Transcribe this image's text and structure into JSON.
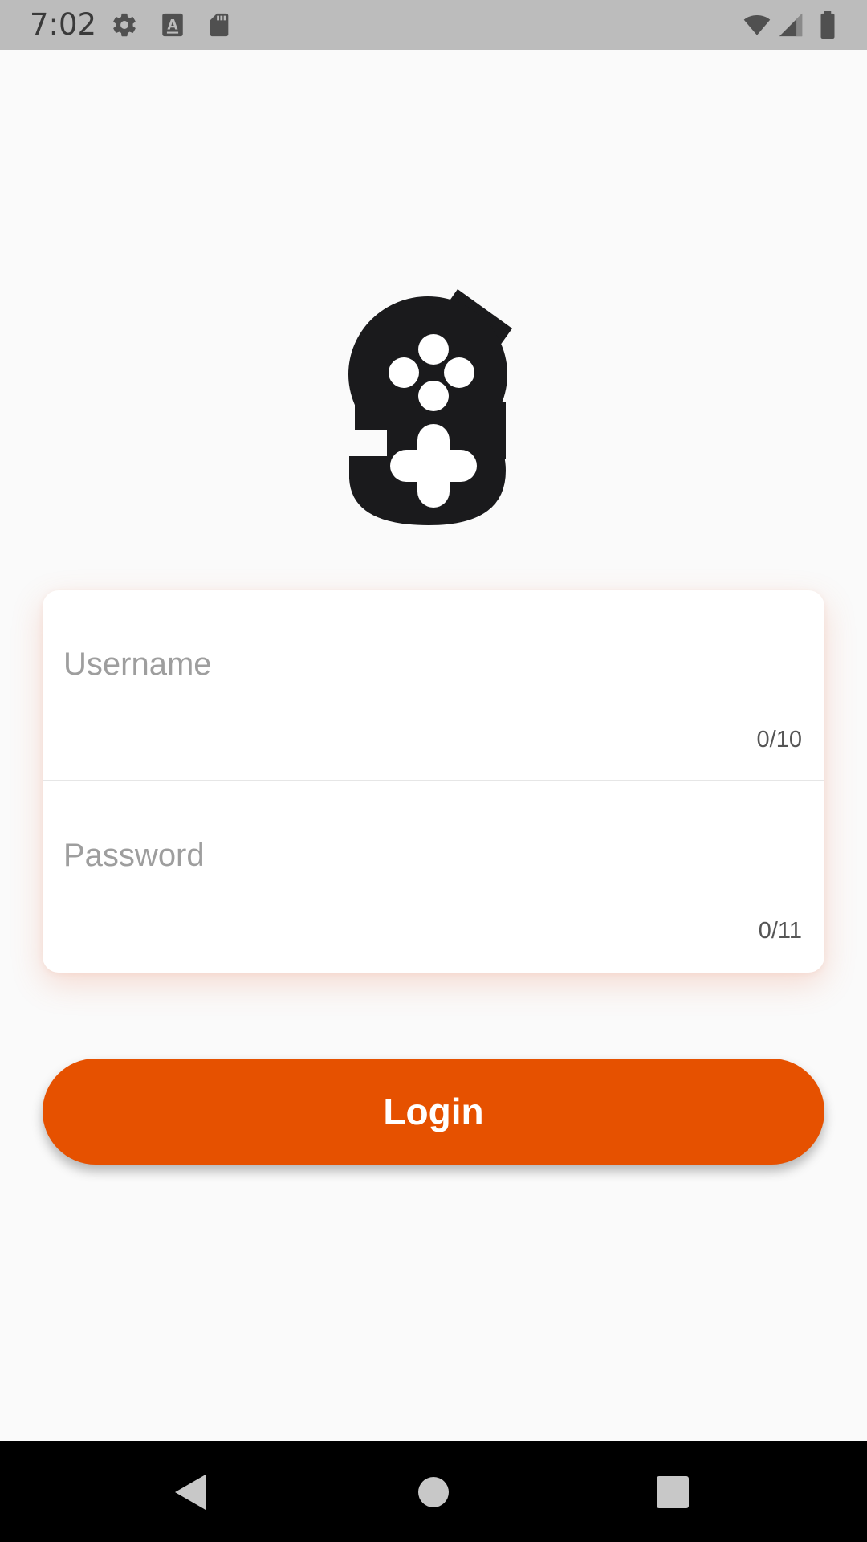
{
  "status_bar": {
    "time": "7:02",
    "icons": [
      "settings-icon",
      "font-a-icon",
      "sd-card-icon",
      "wifi-icon",
      "signal-icon",
      "battery-icon"
    ],
    "background": "#bcbcbc"
  },
  "logo": {
    "icon": "gamepad-g-logo-icon",
    "color": "#1a1a1c"
  },
  "form": {
    "username": {
      "placeholder": "Username",
      "value": "",
      "counter": "0/10"
    },
    "password": {
      "placeholder": "Password",
      "value": "",
      "counter": "0/11"
    }
  },
  "login_button": {
    "label": "Login",
    "color": "#e65100"
  },
  "nav_bar": {
    "buttons": [
      "back-icon",
      "home-icon",
      "recents-icon"
    ]
  }
}
